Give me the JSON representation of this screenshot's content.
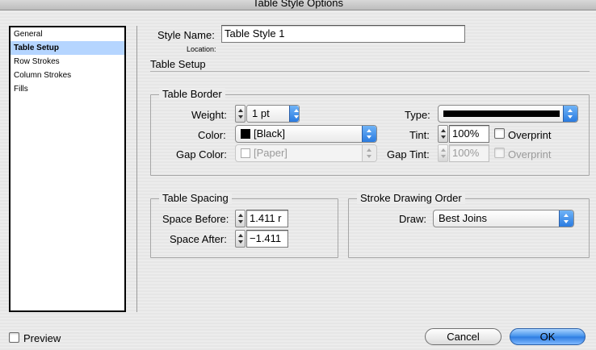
{
  "window": {
    "title": "Table Style Options"
  },
  "sidebar": {
    "items": [
      {
        "label": "General",
        "selected": false
      },
      {
        "label": "Table Setup",
        "selected": true
      },
      {
        "label": "Row Strokes",
        "selected": false
      },
      {
        "label": "Column Strokes",
        "selected": false
      },
      {
        "label": "Fills",
        "selected": false
      }
    ]
  },
  "style_name": {
    "label": "Style Name:",
    "value": "Table Style 1",
    "location_label": "Location:"
  },
  "section_title": "Table Setup",
  "table_border": {
    "title": "Table Border",
    "weight_label": "Weight:",
    "weight_value": "1 pt",
    "type_label": "Type:",
    "color_label": "Color:",
    "color_value": "[Black]",
    "tint_label": "Tint:",
    "tint_value": "100%",
    "overprint_label": "Overprint",
    "gap_color_label": "Gap Color:",
    "gap_color_value": "[Paper]",
    "gap_tint_label": "Gap Tint:",
    "gap_tint_value": "100%",
    "gap_overprint_label": "Overprint"
  },
  "table_spacing": {
    "title": "Table Spacing",
    "space_before_label": "Space Before:",
    "space_before_value": "1.411 r",
    "space_after_label": "Space After:",
    "space_after_value": "−1.411"
  },
  "stroke_drawing_order": {
    "title": "Stroke Drawing Order",
    "draw_label": "Draw:",
    "draw_value": "Best Joins"
  },
  "footer": {
    "preview_label": "Preview",
    "cancel_label": "Cancel",
    "ok_label": "OK"
  },
  "colors": {
    "selection": "#b5d5ff",
    "accent": "#2b7ae0"
  }
}
